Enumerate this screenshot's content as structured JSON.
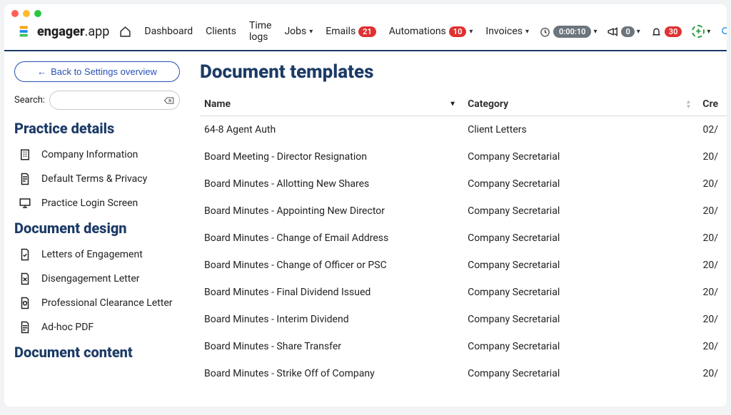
{
  "brand": {
    "name": "engager",
    "suffix": ".app"
  },
  "nav": {
    "home": "",
    "dashboard": "Dashboard",
    "clients": "Clients",
    "timelogs": "Time logs",
    "jobs": "Jobs",
    "emails": "Emails",
    "emails_badge": "21",
    "automations": "Automations",
    "automations_badge": "10",
    "invoices": "Invoices",
    "timer": "0:00:10",
    "announce_badge": "0",
    "bell_badge": "30"
  },
  "sidebar": {
    "back": "Back to Settings overview",
    "search_label": "Search:",
    "sections": {
      "practice_details": {
        "title": "Practice details",
        "items": [
          "Company Information",
          "Default Terms & Privacy",
          "Practice Login Screen"
        ]
      },
      "document_design": {
        "title": "Document design",
        "items": [
          "Letters of Engagement",
          "Disengagement Letter",
          "Professional Clearance Letter",
          "Ad-hoc PDF"
        ]
      },
      "document_content": {
        "title": "Document content"
      }
    }
  },
  "main": {
    "title": "Document templates",
    "columns": {
      "name": "Name",
      "category": "Category",
      "created": "Cre"
    },
    "rows": [
      {
        "name": "64-8 Agent Auth",
        "category": "Client Letters",
        "created": "02/"
      },
      {
        "name": "Board Meeting - Director Resignation",
        "category": "Company Secretarial",
        "created": "20/"
      },
      {
        "name": "Board Minutes - Allotting New Shares",
        "category": "Company Secretarial",
        "created": "20/"
      },
      {
        "name": "Board Minutes - Appointing New Director",
        "category": "Company Secretarial",
        "created": "20/"
      },
      {
        "name": "Board Minutes - Change of Email Address",
        "category": "Company Secretarial",
        "created": "20/"
      },
      {
        "name": "Board Minutes - Change of Officer or PSC",
        "category": "Company Secretarial",
        "created": "20/"
      },
      {
        "name": "Board Minutes - Final Dividend Issued",
        "category": "Company Secretarial",
        "created": "20/"
      },
      {
        "name": "Board Minutes - Interim Dividend",
        "category": "Company Secretarial",
        "created": "20/"
      },
      {
        "name": "Board Minutes - Share Transfer",
        "category": "Company Secretarial",
        "created": "20/"
      },
      {
        "name": "Board Minutes - Strike Off of Company",
        "category": "Company Secretarial",
        "created": "20/"
      }
    ]
  }
}
